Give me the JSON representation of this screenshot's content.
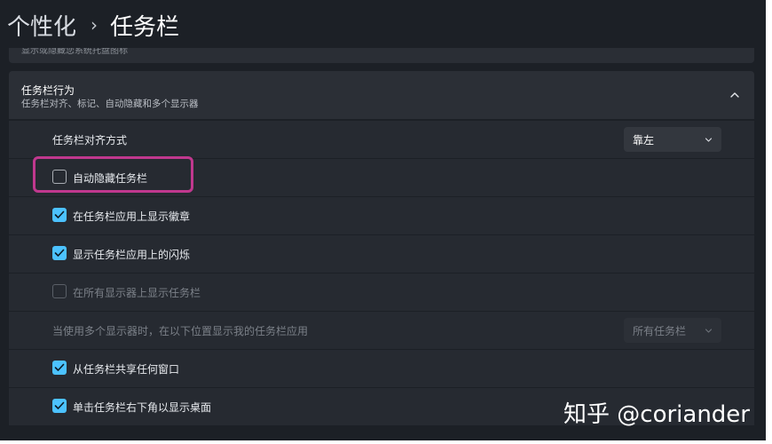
{
  "breadcrumb": {
    "parent": "个性化",
    "separator": "›",
    "current": "任务栏"
  },
  "peek_card": {
    "text": "显示或隐藏您系统托盘图标"
  },
  "group": {
    "title": "任务栏行为",
    "subtitle": "任务栏对齐、标记、自动隐藏和多个显示器",
    "expanded": true,
    "chevron_icon": "chevron-up-icon"
  },
  "rows": {
    "alignment": {
      "label": "任务栏对齐方式",
      "value": "靠左"
    },
    "autohide": {
      "label": "自动隐藏任务栏",
      "checked": false,
      "highlighted": true
    },
    "badges": {
      "label": "在任务栏应用上显示徽章",
      "checked": true
    },
    "flashing": {
      "label": "显示任务栏应用上的闪烁",
      "checked": true
    },
    "all_displays": {
      "label": "在所有显示器上显示任务栏",
      "checked": false,
      "disabled": true
    },
    "multi_display": {
      "label": "当使用多个显示器时，在以下位置显示我的任务栏应用",
      "value": "所有任务栏",
      "disabled": true
    },
    "share_window": {
      "label": "从任务栏共享任何窗口",
      "checked": true
    },
    "show_desktop": {
      "label": "单击任务栏右下角以显示桌面",
      "checked": true
    }
  },
  "watermark": "知乎 @coriander",
  "colors": {
    "accent": "#4cc2ff",
    "highlight_border": "#c0388e",
    "background": "#1c2026",
    "card": "#262a31"
  }
}
